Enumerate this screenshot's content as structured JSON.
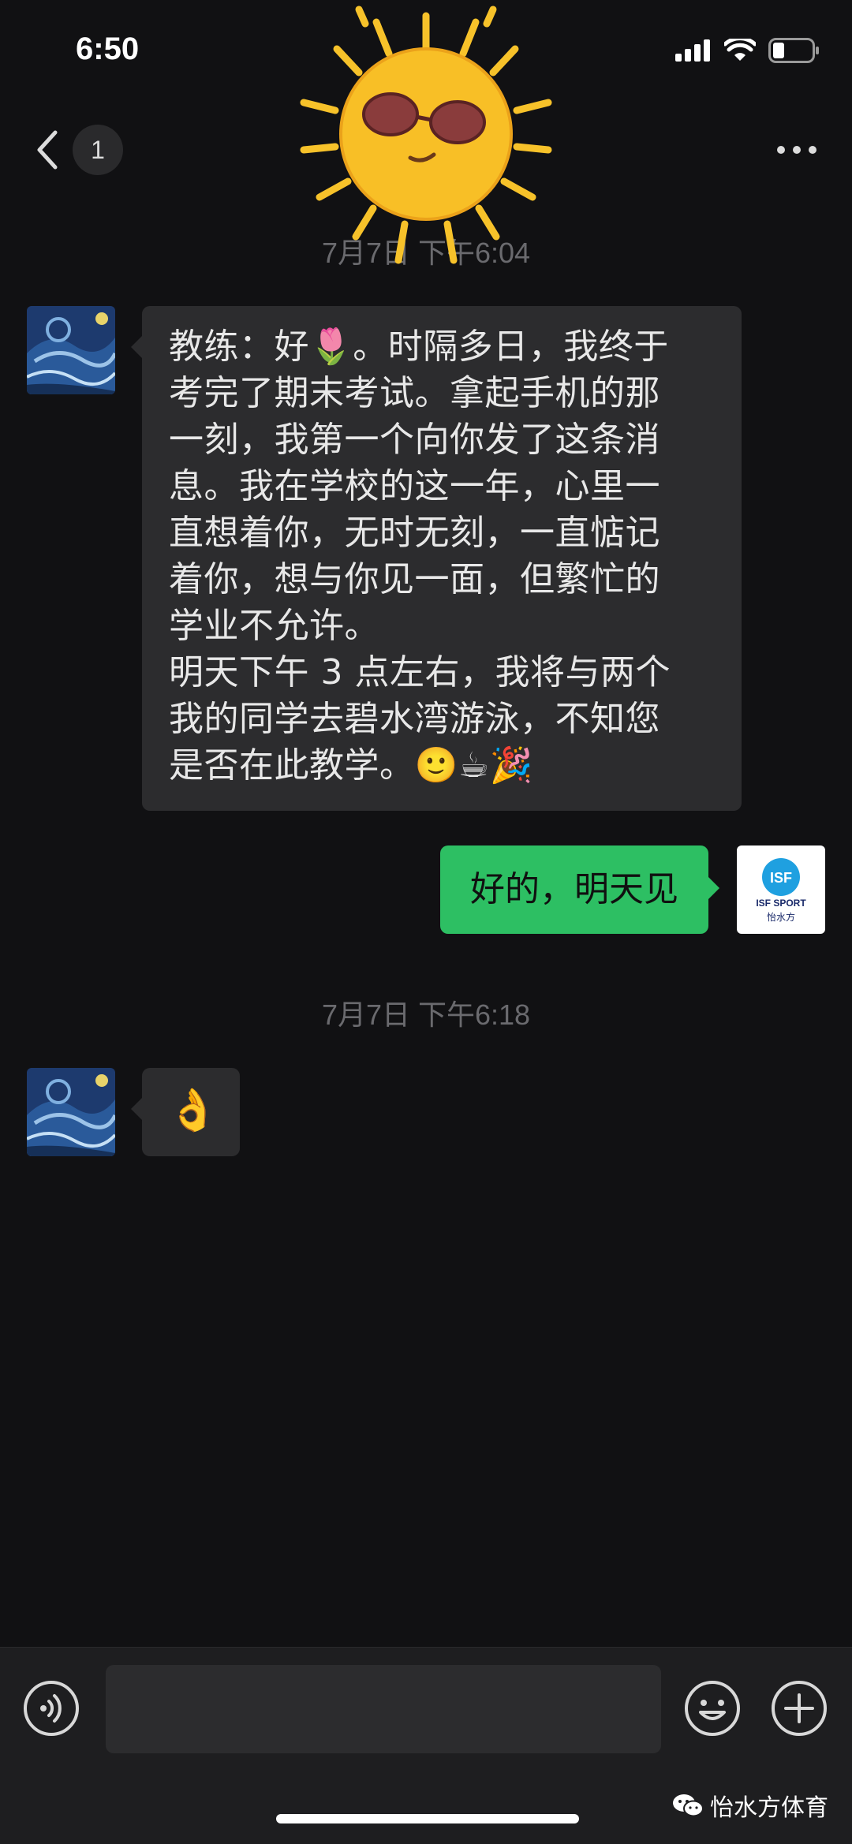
{
  "status_bar": {
    "time": "6:50"
  },
  "header": {
    "unread_count": "1",
    "back_icon": "chevron-left-icon",
    "more_icon": "ellipsis-icon"
  },
  "chat": {
    "timestamp_1": "7月7日 下午6:04",
    "incoming_1": {
      "lines": [
        "教练：好🌷。时隔多日，我终于",
        "考完了期末考试。拿起手机的那",
        "一刻，我第一个向你发了这条消",
        "息。我在学校的这一年，心里一",
        "直想着你，无时无刻，一直惦记",
        "着你，想与你见一面，但繁忙的",
        "学业不允许。",
        "明天下午 3 点左右，我将与两个",
        "我的同学去碧水湾游泳，不知您",
        "是否在此教学。🙂☕🎉"
      ]
    },
    "outgoing_1": "好的，明天见",
    "self_avatar": {
      "brand_en": "ISF SPORT",
      "brand_cn": "怡水方"
    },
    "timestamp_2": "7月7日 下午6:18",
    "incoming_2": "👌"
  },
  "input_bar": {
    "voice_icon": "voice-icon",
    "emoji_icon": "emoji-icon",
    "plus_icon": "plus-icon"
  },
  "watermark": {
    "text": "怡水方体育",
    "icon": "wechat-icon"
  },
  "colors": {
    "background": "#111113",
    "incoming_bubble": "#2c2c2e",
    "outgoing_bubble": "#2dbf63",
    "sun": "#f7c22a"
  }
}
